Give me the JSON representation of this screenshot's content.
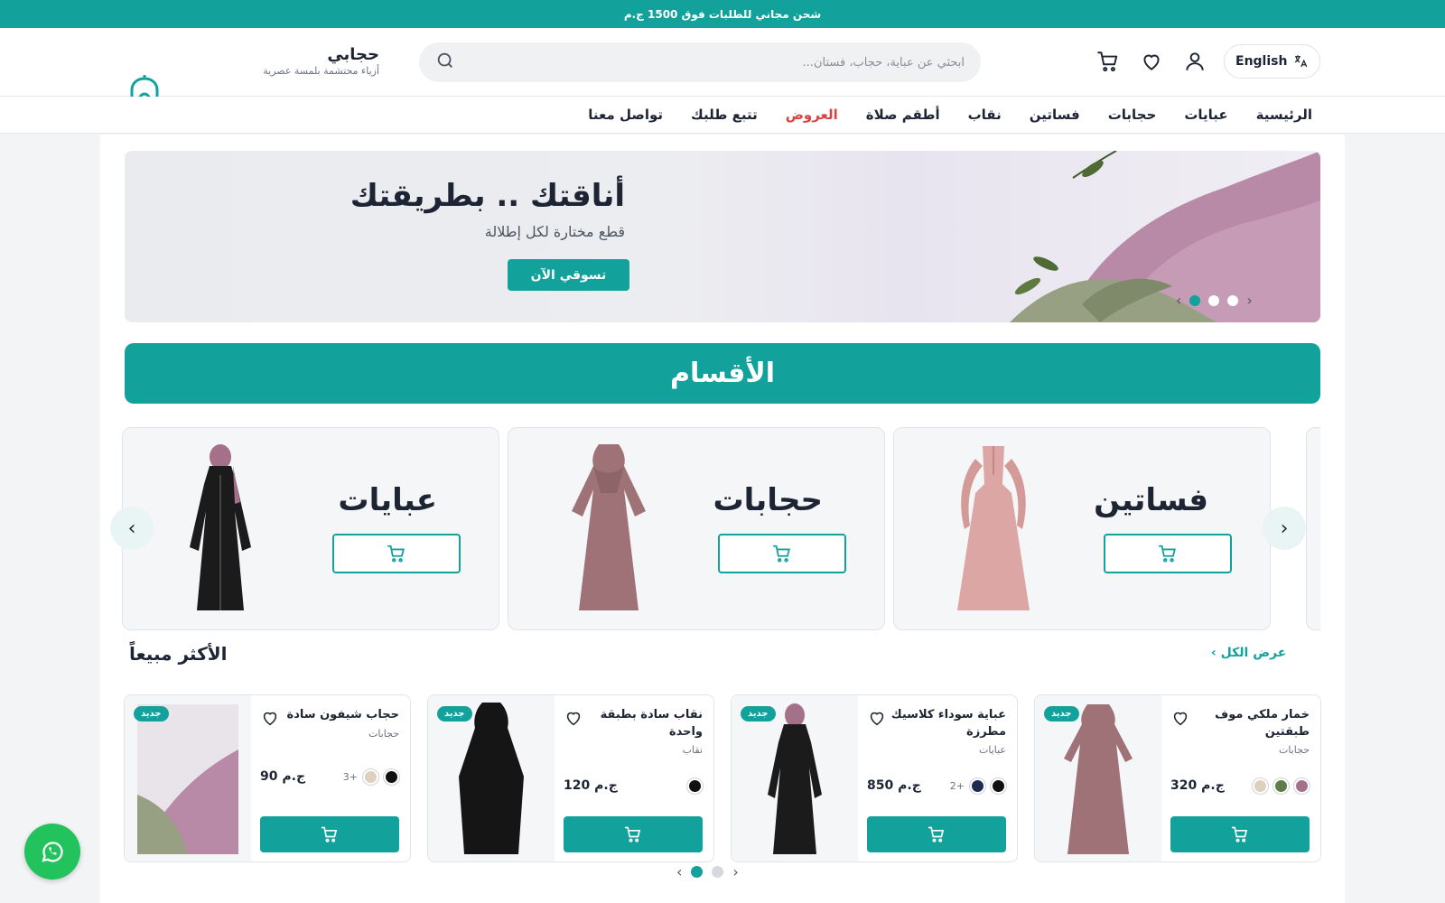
{
  "topbar": {
    "text": "شحن مجاني للطلبات فوق 1500 ج.م"
  },
  "header": {
    "brand_name": "حجابي",
    "brand_tagline": "أزياء محتشمة بلمسة عصرية",
    "search_placeholder": "ابحثي عن عباية، حجاب، فستان...",
    "language_label": "English"
  },
  "nav": {
    "items": [
      {
        "label": "الرئيسية"
      },
      {
        "label": "عبايات"
      },
      {
        "label": "حجابات"
      },
      {
        "label": "فساتين"
      },
      {
        "label": "نقاب"
      },
      {
        "label": "أطقم صلاة"
      },
      {
        "label": "العروض"
      },
      {
        "label": "تتبع طلبك"
      },
      {
        "label": "تواصل معنا"
      }
    ]
  },
  "hero": {
    "title": "أناقتك .. بطريقتك",
    "subtitle": "قطع مختارة لكل إطلالة",
    "cta": "تسوقي الآن",
    "slide_count": 3,
    "active_slide": 1
  },
  "categories": {
    "heading": "الأقسام",
    "items": [
      {
        "title": "فساتين",
        "color": "#dba6a4"
      },
      {
        "title": "حجابات",
        "color": "#9e7276"
      },
      {
        "title": "عبايات",
        "color": "#1b1b1b"
      }
    ]
  },
  "bestsellers": {
    "heading": "الأكثر مبيعاً",
    "view_all": "عرض الكل",
    "products": [
      {
        "name": "خمار ملكي موف طبقتين",
        "category": "حجابات",
        "price": "320 ج.م",
        "badge": "جديد",
        "swatches": [
          "#a4708a",
          "#5f7c4b",
          "#ddd0bd"
        ],
        "more": ""
      },
      {
        "name": "عباية سوداء كلاسيك مطرزة",
        "category": "عبايات",
        "price": "850 ج.م",
        "badge": "جديد",
        "swatches": [
          "#111111",
          "#1e2a4f"
        ],
        "more": "+2"
      },
      {
        "name": "نقاب سادة بطبقة واحدة",
        "category": "نقاب",
        "price": "120 ج.م",
        "badge": "جديد",
        "swatches": [
          "#111111"
        ],
        "more": ""
      },
      {
        "name": "حجاب شيفون سادة",
        "category": "حجابات",
        "price": "90 ج.م",
        "badge": "جديد",
        "swatches": [
          "#111111",
          "#ddd0bd"
        ],
        "more": "+3"
      }
    ],
    "page_count": 2,
    "active_page": 1
  },
  "colors": {
    "accent": "#13a19c",
    "offer": "#d94343",
    "whatsapp": "#22c25d"
  }
}
